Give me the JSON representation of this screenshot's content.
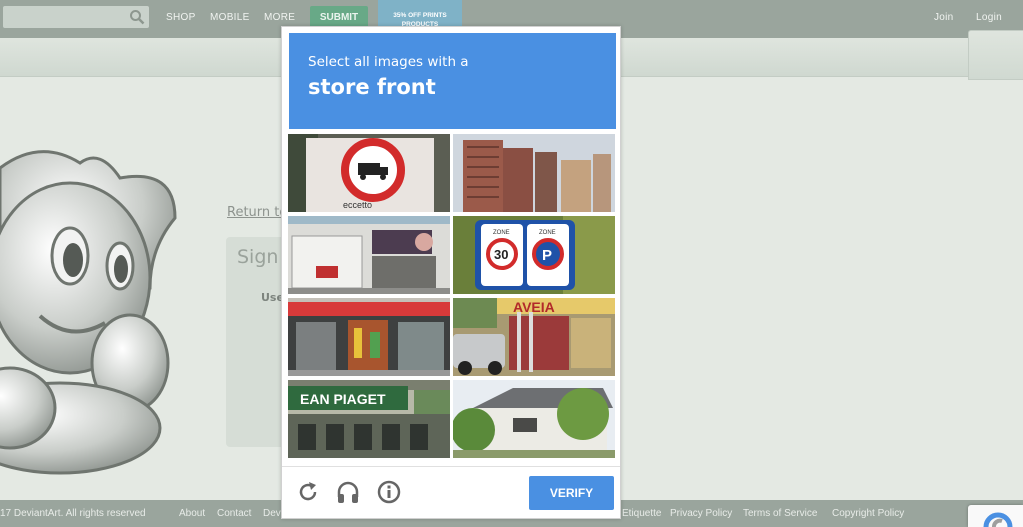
{
  "nav": {
    "shop": "SHOP",
    "mobile": "MOBILE",
    "more": "MORE",
    "submit": "SUBMIT",
    "join": "Join",
    "login": "Login"
  },
  "promo": {
    "line1": "35% OFF PRINTS",
    "line2": "PRODUCTS"
  },
  "page": {
    "return_link": "Return to",
    "signin_title": "Sign I",
    "username_label": "Use"
  },
  "footer": {
    "copyright": "17 DeviantArt. All rights reserved",
    "links_left": [
      "About",
      "Contact",
      "Dev"
    ],
    "links_right": [
      "Etiquette",
      "Privacy Policy",
      "Terms of Service",
      "Copyright Policy"
    ]
  },
  "captcha": {
    "instruction": "Select all images with a",
    "target": "store front",
    "verify_label": "VERIFY",
    "colors": {
      "accent": "#4a90e2"
    },
    "icons": {
      "reload": "reload-icon",
      "audio": "headphones-icon",
      "info": "info-icon"
    },
    "tiles": [
      {
        "scene": "no-trucks-sign",
        "sign_text": "eccetto"
      },
      {
        "scene": "apartment-towers"
      },
      {
        "scene": "shop-with-billboard"
      },
      {
        "scene": "zone-30-parking-signs",
        "sign_text": [
          "ZONE",
          "30",
          "ZONE",
          "P"
        ]
      },
      {
        "scene": "colorful-store"
      },
      {
        "scene": "shop-with-truck",
        "sign_text": "AVEIA"
      },
      {
        "scene": "building-green-sign",
        "sign_text": "EAN PIAGET"
      },
      {
        "scene": "house-with-trees"
      }
    ]
  }
}
